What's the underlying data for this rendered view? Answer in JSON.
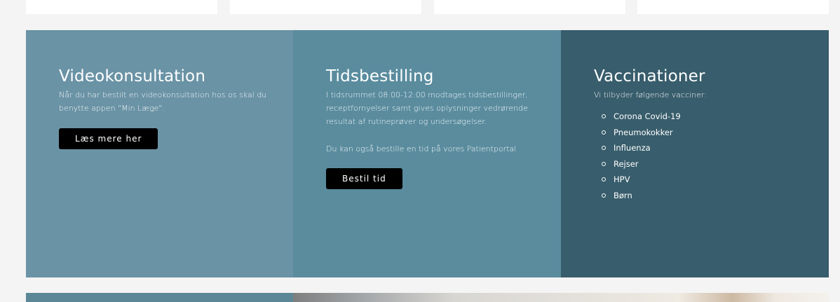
{
  "colors": {
    "page_background": "#f4f4f4",
    "panel_videokonsultation": "#6a93a5",
    "panel_tidsbestilling": "#5a8c9e",
    "panel_vaccinationer": "#385d6c",
    "button_background": "#000000"
  },
  "panels": {
    "video": {
      "title": "Videokonsultation",
      "text": "Når du har bestilt en videokonsultation hos os skal du benytte appen \"Min Læge\".",
      "button": "Læs mere her"
    },
    "booking": {
      "title": "Tidsbestilling",
      "text": "I tidsrummet 08:00-12:00 modtages tidsbestillinger, receptfornyelser samt gives oplysninger vedrørende resultat af rutineprøver og undersøgelser.",
      "text2": "Du kan også bestille en tid på vores Patientportal",
      "button": "Bestil tid"
    },
    "vaccines": {
      "title": "Vaccinationer",
      "intro": "Vi tilbyder følgende vacciner:",
      "items": [
        "Corona Covid-19",
        "Pneumokokker",
        "Influenza",
        "Rejser",
        "HPV",
        "Børn"
      ]
    }
  }
}
